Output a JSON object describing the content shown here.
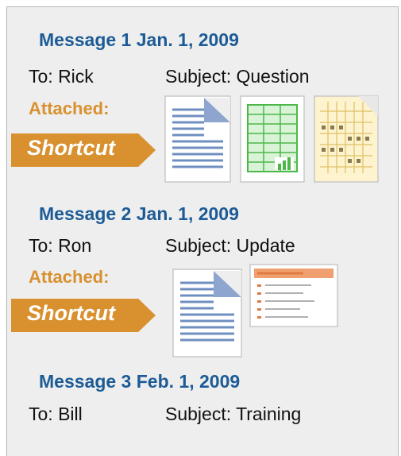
{
  "colors": {
    "heading": "#1c5b96",
    "attached": "#d8912e",
    "shortcut_bg": "#d8912e",
    "text": "#111111",
    "panel_bg": "#eeeeee"
  },
  "messages": [
    {
      "title": "Message 1 Jan. 1, 2009",
      "to": "To: Rick",
      "subject": "Subject: Question",
      "attached_label": "Attached:",
      "shortcut_label": "Shortcut",
      "attachments": [
        "document-icon",
        "spreadsheet-icon",
        "calendar-icon"
      ]
    },
    {
      "title": "Message 2 Jan. 1, 2009",
      "to": "To: Ron",
      "subject": "Subject: Update",
      "attached_label": "Attached:",
      "shortcut_label": "Shortcut",
      "attachments": [
        "document-icon",
        "presentation-icon"
      ]
    },
    {
      "title": "Message 3 Feb. 1, 2009",
      "to": "To: Bill",
      "subject": "Subject: Training"
    }
  ]
}
